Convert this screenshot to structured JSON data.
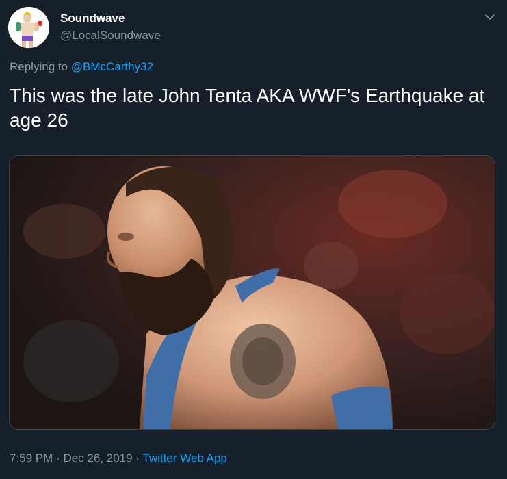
{
  "author": {
    "display_name": "Soundwave",
    "handle": "@LocalSoundwave"
  },
  "reply": {
    "prefix": "Replying to",
    "to_handle": "@BMcCarthy32"
  },
  "tweet": {
    "text": "This was the late John Tenta AKA WWF's Earthquake at age 26"
  },
  "meta": {
    "time": "7:59 PM",
    "separator": "·",
    "date": "Dec 26, 2019",
    "source": "Twitter Web App"
  },
  "icons": {
    "menu": "chevron-down-icon",
    "avatar": "avatar"
  },
  "colors": {
    "background": "#15202b",
    "secondary_text": "#8899a6",
    "link": "#1da1f2",
    "primary_text": "#ffffff"
  }
}
